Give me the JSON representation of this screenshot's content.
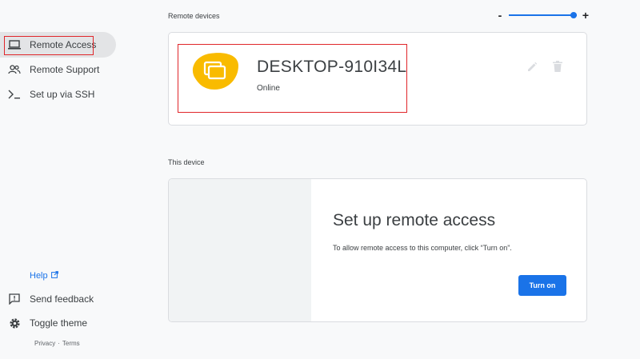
{
  "sidebar": {
    "items": [
      {
        "label": "Remote Access",
        "icon": "laptop-icon"
      },
      {
        "label": "Remote Support",
        "icon": "people-icon"
      },
      {
        "label": "Set up via SSH",
        "icon": "terminal-icon"
      }
    ],
    "help_label": "Help",
    "send_feedback_label": "Send feedback",
    "toggle_theme_label": "Toggle theme",
    "privacy_label": "Privacy",
    "separator": "·",
    "terms_label": "Terms"
  },
  "remote_devices": {
    "section_title": "Remote devices",
    "zoom": {
      "minus": "-",
      "plus": "+",
      "level": 1.0
    },
    "device": {
      "name": "DESKTOP-910I34L",
      "status": "Online",
      "icon": "remote-desktop-icon"
    }
  },
  "this_device": {
    "section_title": "This device",
    "setup_title": "Set up remote access",
    "setup_description": "To allow remote access to this computer, click “Turn on”.",
    "turn_on_label": "Turn on"
  },
  "colors": {
    "accent": "#1a73e8",
    "highlight_box": "#e0262a",
    "device_blob": "#f9bb00"
  }
}
